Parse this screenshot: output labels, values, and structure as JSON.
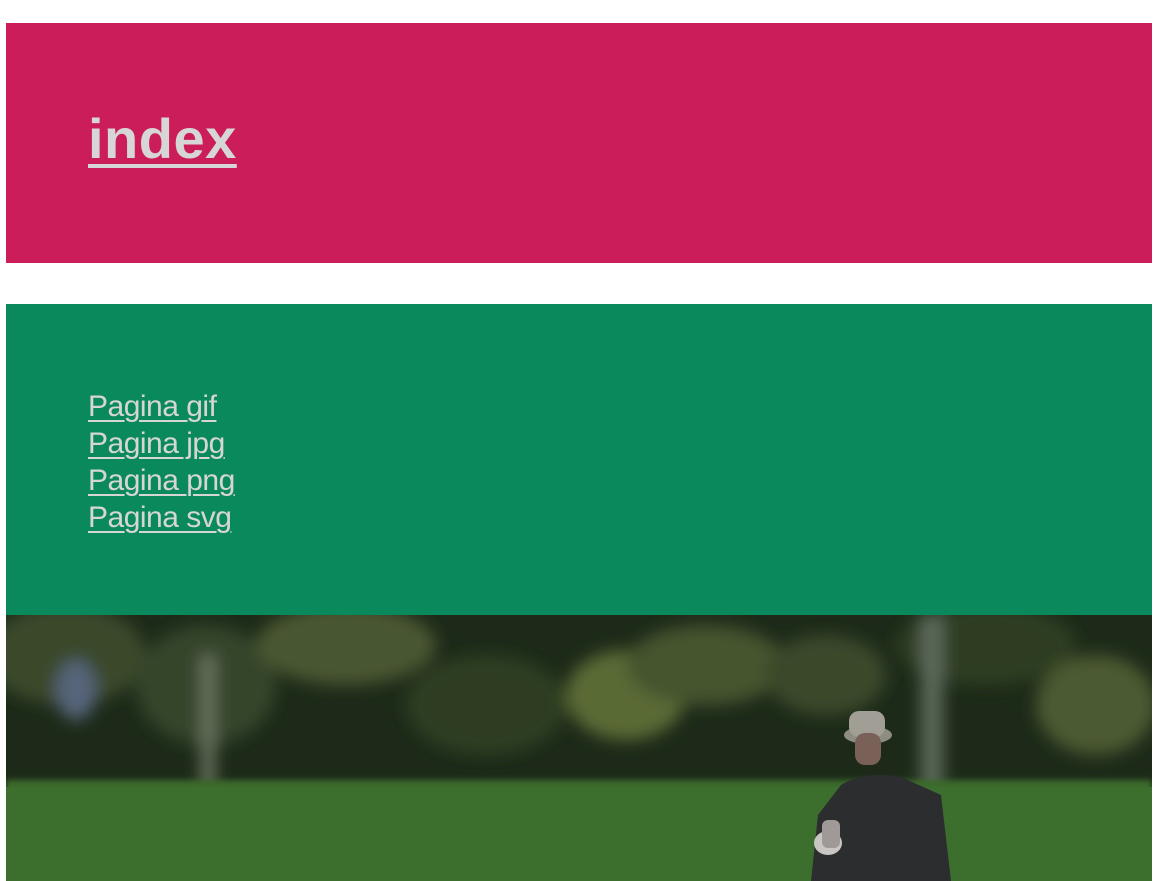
{
  "header": {
    "title": "index",
    "background": "#cb1d5a"
  },
  "nav": {
    "background": "#0a8a5c",
    "links": [
      {
        "label": "Pagina gif"
      },
      {
        "label": "Pagina jpg"
      },
      {
        "label": "Pagina png"
      },
      {
        "label": "Pagina svg"
      }
    ]
  },
  "hero": {
    "description_icon": "photo-park-person"
  },
  "colors": {
    "link_text": "#d6d6d6"
  }
}
